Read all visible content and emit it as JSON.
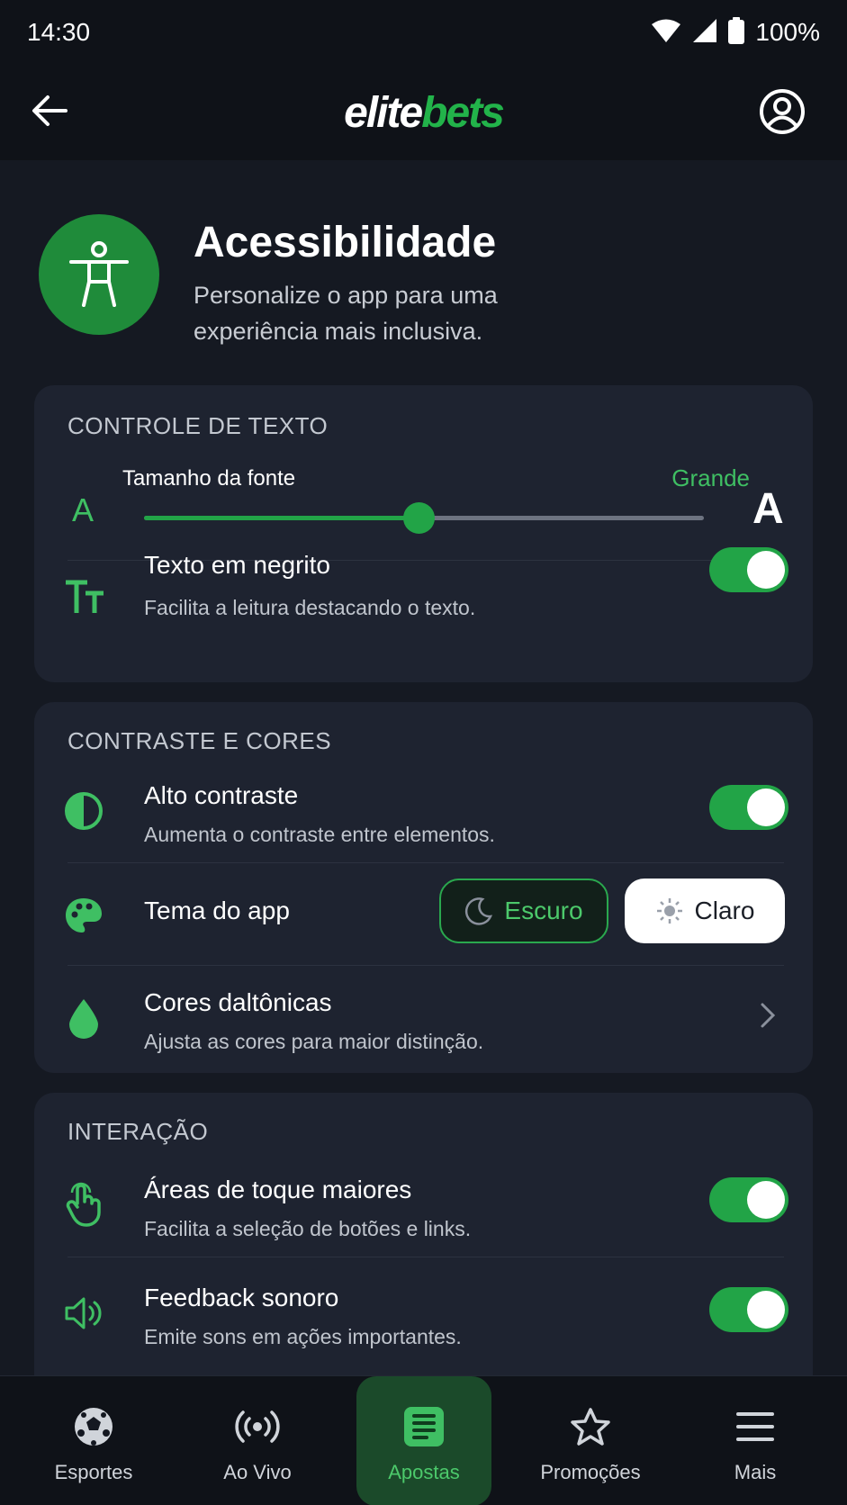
{
  "status_bar": {
    "time": "14:30",
    "battery": "100%"
  },
  "header": {
    "logo_part1": "elite",
    "logo_part2": "bets"
  },
  "page": {
    "title": "Acessibilidade",
    "subtitle": "Personalize o app para uma experiência mais inclusiva."
  },
  "text_control": {
    "section_title": "CONTROLE DE TEXTO",
    "font_size_label": "Tamanho da fonte",
    "font_size_value": "Grande",
    "small_a": "A",
    "large_a": "A",
    "font_size_level": 0.49,
    "bold_label": "Texto em negrito",
    "bold_desc": "Facilita a leitura destacando o texto.",
    "bold_on": true
  },
  "contrast": {
    "section_title": "CONTRASTE E CORES",
    "high_contrast_label": "Alto contraste",
    "high_contrast_desc": "Aumenta o contraste entre elementos.",
    "high_contrast_on": true,
    "theme_label": "Tema do app",
    "theme_dark": "Escuro",
    "theme_light": "Claro",
    "theme_selected": "Escuro",
    "colorblind_label": "Cores daltônicas",
    "colorblind_desc": "Ajusta as cores para maior distinção."
  },
  "interaction": {
    "section_title": "INTERAÇÃO",
    "touch_label": "Áreas de toque maiores",
    "touch_desc": "Facilita a seleção de botões e links.",
    "touch_on": true,
    "sound_label": "Feedback sonoro",
    "sound_desc": "Emite sons em ações importantes.",
    "sound_on": true
  },
  "bottom_nav": {
    "items": [
      {
        "label": "Esportes",
        "icon": "soccer-ball-icon"
      },
      {
        "label": "Ao Vivo",
        "icon": "live-broadcast-icon"
      },
      {
        "label": "Apostas",
        "icon": "bet-slip-icon"
      },
      {
        "label": "Promoções",
        "icon": "star-icon"
      },
      {
        "label": "Mais",
        "icon": "menu-icon"
      }
    ],
    "active": "Apostas"
  },
  "colors": {
    "accent": "#22a447",
    "background": "#151922",
    "card": "#1e2330"
  }
}
